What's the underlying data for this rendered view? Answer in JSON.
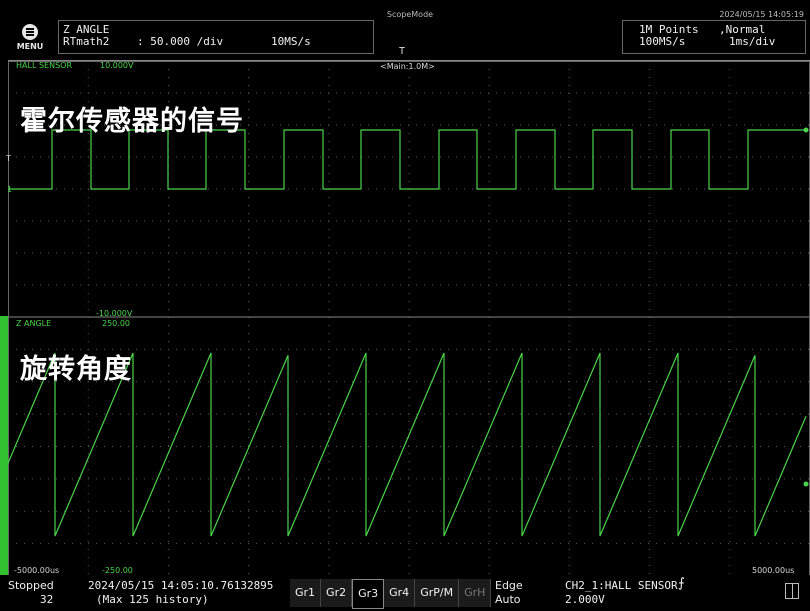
{
  "header": {
    "scope_mode": "ScopeMode",
    "datetime": "2024/05/15 14:05:19",
    "menu_label": "MENU",
    "channel": {
      "name": "Z ANGLE",
      "source": "RTmath2",
      "div": ":  50.000 /div",
      "rate": "10MS/s"
    },
    "acquisition": {
      "points": "1M Points",
      "mode": ",Normal",
      "rate": "100MS/s",
      "time_div": "1ms/div"
    },
    "trigger_marker": "T"
  },
  "ch1": {
    "name": "HALL SENSOR",
    "top_value": "10.000V",
    "bottom_value": "-10.000V",
    "overlay_title": "霍尔传感器的信号",
    "main_label": "<Main:1.0M>",
    "level_marker": "T",
    "zero_marker": "1"
  },
  "ch2": {
    "name": "Z ANGLE",
    "top_value": "250.00",
    "bottom_value": "-250.00",
    "overlay_title": "旋转角度",
    "left_time": "-5000.00us",
    "right_time": "5000.00us"
  },
  "status": {
    "run_state": "Stopped",
    "acq_count": "32",
    "history_time": "2024/05/15 14:05:10.76132895",
    "history_max": "(Max 125 history)",
    "groups": [
      {
        "label": "Gr1",
        "active": false,
        "disabled": false
      },
      {
        "label": "Gr2",
        "active": false,
        "disabled": false
      },
      {
        "label": "Gr3",
        "active": true,
        "disabled": false
      },
      {
        "label": "Gr4",
        "active": false,
        "disabled": false
      },
      {
        "label": "GrP/M",
        "active": false,
        "disabled": false
      },
      {
        "label": "GrH",
        "active": false,
        "disabled": true
      }
    ],
    "trigger_type": "Edge",
    "trigger_mode": "Auto",
    "trigger_source": "CH2_1:HALL SENSOR",
    "trigger_level": "2.000V"
  },
  "colors": {
    "trace": "#4bd34b",
    "grid": "#5a5a5a",
    "background": "#000000"
  },
  "waveform": {
    "hall_transitions": [
      44,
      83,
      121,
      160,
      198,
      237,
      276,
      315,
      353,
      392,
      431,
      469,
      508,
      547,
      585,
      624,
      663,
      701,
      740
    ],
    "hall_start_level": "low",
    "angle_resets": [
      47,
      125,
      203,
      280,
      358,
      436,
      514,
      592,
      670,
      747
    ]
  }
}
